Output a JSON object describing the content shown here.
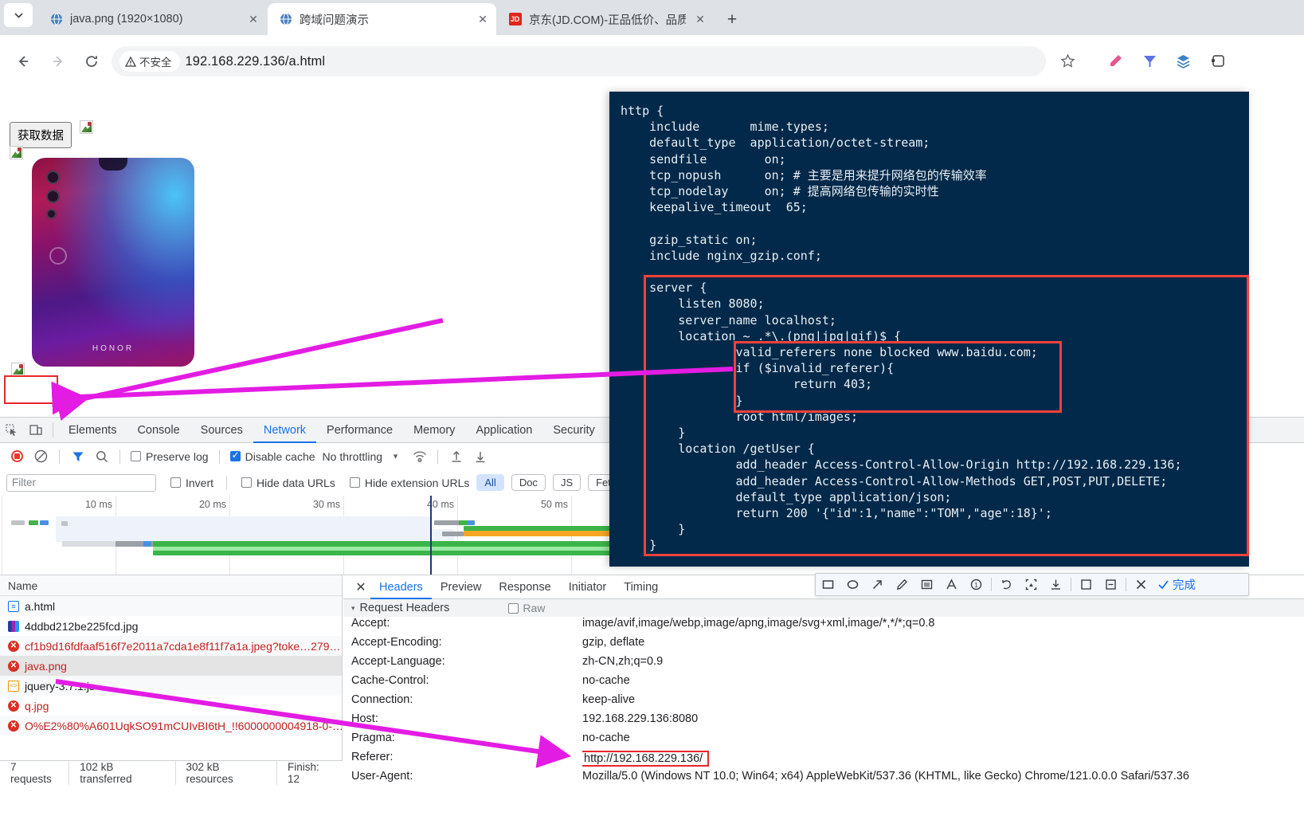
{
  "browser": {
    "tabs": [
      {
        "title": "java.png (1920×1080)",
        "favicon": "globe-icon",
        "active": false
      },
      {
        "title": "跨域问题演示",
        "favicon": "globe-icon",
        "active": true
      },
      {
        "title": "京东(JD.COM)-正品低价、品质",
        "favicon": "jd-icon",
        "active": false
      }
    ],
    "new_tab_label": "+",
    "tab_search_icon": "chevron-down-icon",
    "nav": {
      "back_icon": "arrow-left-icon",
      "forward_icon": "arrow-right-icon",
      "reload_icon": "reload-icon"
    },
    "omnibox": {
      "security_label": "不安全",
      "security_icon": "warning-triangle-icon",
      "url": "192.168.229.136/a.html"
    },
    "toolbar_icons": [
      "star-icon",
      "highlighter-icon",
      "download-funnel-icon",
      "layers-icon",
      "extensions-icon"
    ]
  },
  "page": {
    "get_data_button": "获取数据",
    "broken_image_icons": [
      "broken-image-icon",
      "broken-image-icon",
      "broken-image-icon"
    ],
    "phone_brand": "HONOR"
  },
  "nginx_config": {
    "lines": [
      "http {",
      "    include       mime.types;",
      "    default_type  application/octet-stream;",
      "    sendfile        on;",
      "    tcp_nopush      on; # 主要是用来提升网络包的传输效率",
      "    tcp_nodelay     on; # 提高网络包传输的实时性",
      "    keepalive_timeout  65;",
      "",
      "    gzip_static on;",
      "    include nginx_gzip.conf;",
      "",
      "    server {",
      "        listen 8080;",
      "        server_name localhost;",
      "        location ~ .*\\.(png|jpg|gif)$ {",
      "                valid_referers none blocked www.baidu.com;",
      "                if ($invalid_referer){",
      "                        return 403;",
      "                }",
      "                root html/images;",
      "        }",
      "        location /getUser {",
      "                add_header Access-Control-Allow-Origin http://192.168.229.136;",
      "                add_header Access-Control-Allow-Methods GET,POST,PUT,DELETE;",
      "                default_type application/json;",
      "                return 200 '{\"id\":1,\"name\":\"TOM\",\"age\":18}';",
      "        }",
      "    }"
    ],
    "highlight_color": "#f2413b",
    "background_color": "#03294a"
  },
  "devtools": {
    "panel_tabs": [
      {
        "label": "Elements",
        "active": false
      },
      {
        "label": "Console",
        "active": false
      },
      {
        "label": "Sources",
        "active": false
      },
      {
        "label": "Network",
        "active": true
      },
      {
        "label": "Performance",
        "active": false
      },
      {
        "label": "Memory",
        "active": false
      },
      {
        "label": "Application",
        "active": false
      },
      {
        "label": "Security",
        "active": false
      }
    ],
    "left_icons": [
      "inspect-element-icon",
      "device-toolbar-icon"
    ],
    "controls": {
      "record_icon": "record-stop-icon",
      "clear_icon": "clear-icon",
      "filter_icon": "filter-funnel-icon",
      "search_icon": "search-icon",
      "preserve_log_label": "Preserve log",
      "preserve_log_checked": false,
      "disable_cache_label": "Disable cache",
      "disable_cache_checked": true,
      "throttling_label": "No throttling",
      "throttling_caret": "▾",
      "wifi_icon": "network-conditions-icon",
      "import_icon": "import-har-icon",
      "export_icon": "export-har-icon"
    },
    "filterbar": {
      "filter_placeholder": "Filter",
      "filter_value": "",
      "invert_label": "Invert",
      "hide_data_urls_label": "Hide data URLs",
      "hide_extension_urls_label": "Hide extension URLs",
      "type_chips": [
        {
          "label": "All",
          "selected": true
        },
        {
          "label": "Doc",
          "selected": false
        },
        {
          "label": "JS",
          "selected": false
        },
        {
          "label": "Fetch/X",
          "selected": false
        }
      ]
    },
    "timeline": {
      "ticks": [
        "10 ms",
        "20 ms",
        "30 ms",
        "40 ms",
        "50 ms"
      ]
    },
    "request_table": {
      "name_column": "Name",
      "rows": [
        {
          "name": "a.html",
          "icon": "document-icon",
          "error": false
        },
        {
          "name": "4ddbd212be225fcd.jpg",
          "icon": "image-icon",
          "error": false
        },
        {
          "name": "cf1b9d16fdfaaf516f7e2011a7cda1e8f11f7a1a.jpeg?toke…279…",
          "icon": "error-icon",
          "error": true
        },
        {
          "name": "java.png",
          "icon": "error-icon",
          "error": true,
          "selected": true
        },
        {
          "name": "jquery-3.7.1.js",
          "icon": "script-icon",
          "error": false
        },
        {
          "name": "q.jpg",
          "icon": "error-icon",
          "error": true
        },
        {
          "name": "O%E2%80%A601UqkSO91mCUIvBI6tH_!!6000000004918-0-…",
          "icon": "error-icon",
          "error": true
        }
      ]
    },
    "status_bar": [
      "7 requests",
      "102 kB transferred",
      "302 kB resources",
      "Finish: 12"
    ],
    "detail": {
      "close_icon": "close-icon",
      "tabs": [
        {
          "label": "Headers",
          "active": true
        },
        {
          "label": "Preview",
          "active": false
        },
        {
          "label": "Response",
          "active": false
        },
        {
          "label": "Initiator",
          "active": false
        },
        {
          "label": "Timing",
          "active": false
        }
      ],
      "section_title": "Request Headers",
      "section_caret": "▾",
      "raw_label": "Raw",
      "raw_checked": false,
      "headers": [
        {
          "key": "Accept:",
          "value": "image/avif,image/webp,image/apng,image/svg+xml,image/*,*/*;q=0.8"
        },
        {
          "key": "Accept-Encoding:",
          "value": "gzip, deflate"
        },
        {
          "key": "Accept-Language:",
          "value": "zh-CN,zh;q=0.9"
        },
        {
          "key": "Cache-Control:",
          "value": "no-cache"
        },
        {
          "key": "Connection:",
          "value": "keep-alive"
        },
        {
          "key": "Host:",
          "value": "192.168.229.136:8080"
        },
        {
          "key": "Pragma:",
          "value": "no-cache"
        },
        {
          "key": "Referer:",
          "value": "http://192.168.229.136/",
          "highlight": true
        },
        {
          "key": "User-Agent:",
          "value": "Mozilla/5.0 (Windows NT 10.0; Win64; x64) AppleWebKit/537.36 (KHTML, like Gecko) Chrome/121.0.0.0 Safari/537.36"
        }
      ]
    }
  },
  "annotation_toolbar": {
    "tools": [
      "rectangle-icon",
      "ellipse-icon",
      "arrow-icon",
      "pen-icon",
      "blur-icon",
      "text-icon",
      "step-number-icon",
      "undo-icon",
      "crop-icon",
      "download-icon",
      "save-icon",
      "bookmark-icon",
      "close-icon"
    ],
    "done_label": "完成",
    "done_icon": "check-icon",
    "accent_color": "#1a73e8"
  },
  "annotations": {
    "arrow_color": "#e31ce3",
    "highlight_border_color": "#e8262d"
  }
}
